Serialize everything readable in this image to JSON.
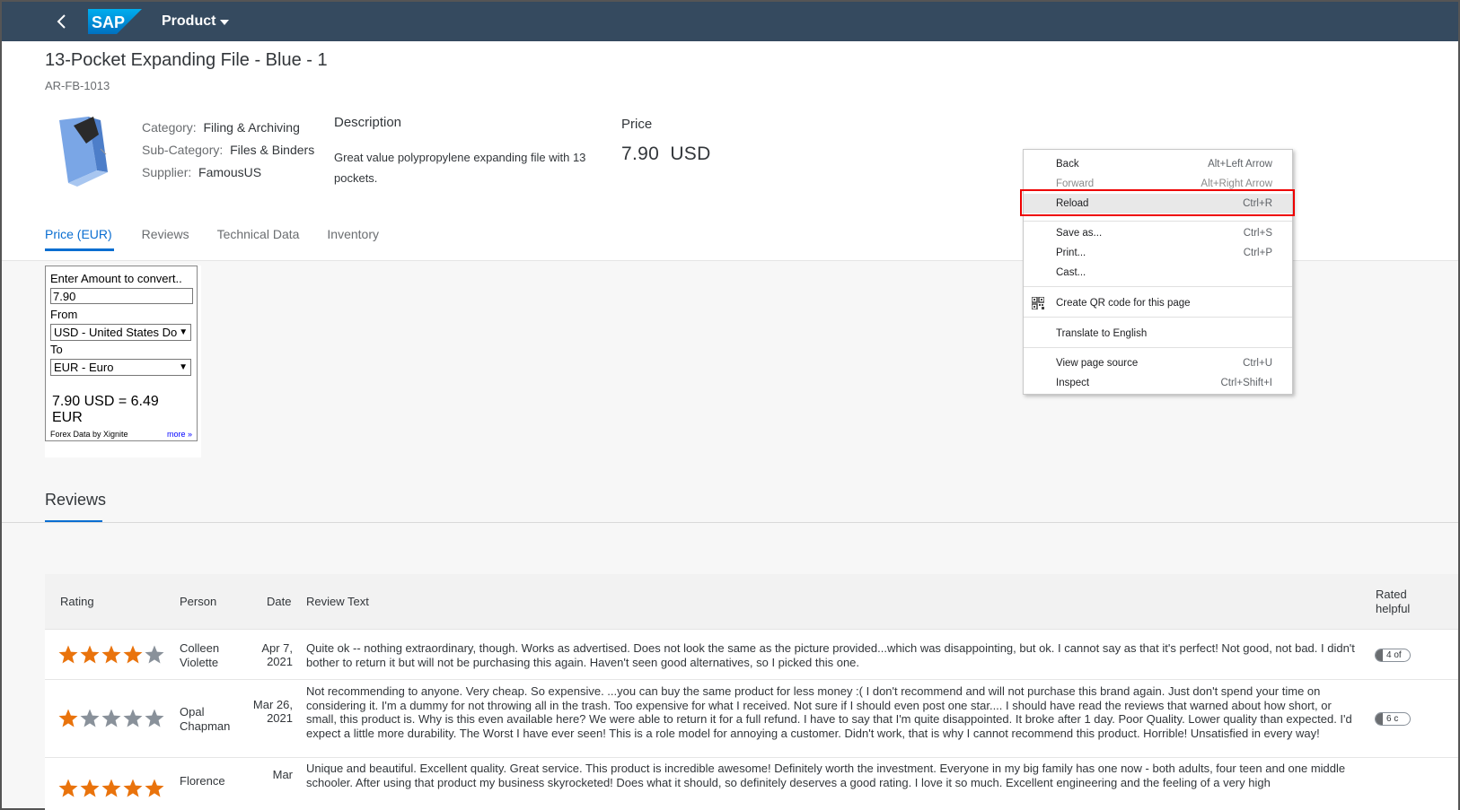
{
  "shell": {
    "app_title": "Product",
    "logo_text": "SAP"
  },
  "product": {
    "title": "13-Pocket Expanding File - Blue - 1",
    "id": "AR-FB-1013",
    "category_label": "Category:",
    "category": "Filing & Archiving",
    "subcategory_label": "Sub-Category:",
    "subcategory": "Files & Binders",
    "supplier_label": "Supplier:",
    "supplier": "FamousUS",
    "description_heading": "Description",
    "description": "Great value polypropylene expanding file with 13 pockets.",
    "price_heading": "Price",
    "price": "7.90  USD"
  },
  "tabs": [
    "Price (EUR)",
    "Reviews",
    "Technical Data",
    "Inventory"
  ],
  "converter": {
    "amount_label": "Enter Amount to convert..",
    "amount_value": "7.90",
    "from_label": "From",
    "from_value": "USD - United States Do",
    "to_label": "To",
    "to_value": "EUR - Euro",
    "result": "7.90 USD = 6.49 EUR",
    "footer": "Forex Data by Xignite",
    "more_link": "more »"
  },
  "reviews": {
    "heading": "Reviews",
    "columns": {
      "rating": "Rating",
      "person": "Person",
      "date": "Date",
      "text": "Review Text",
      "helpful": "Rated helpful"
    },
    "rows": [
      {
        "rating": 4,
        "person": "Colleen Violette",
        "date": "Apr 7, 2021",
        "text": "Quite ok -- nothing extraordinary, though. Works as advertised. Does not look the same as the picture provided...which was disappointing, but ok. I cannot say as that it's perfect! Not good, not bad. I didn't bother to return it but will not be purchasing this again. Haven't seen good alternatives, so I picked this one.",
        "helpful": "4 of"
      },
      {
        "rating": 1,
        "person": "Opal Chapman",
        "date": "Mar 26, 2021",
        "text": "Not recommending to anyone. Very cheap. So expensive. ...you can buy the same product for less money :( I don't recommend and will not purchase this brand again. Just don't spend your time on considering it. I'm a dummy for not throwing all in the trash. Too expensive for what I received. Not sure if I should even post one star.... I should have read the reviews that warned about how short, or small, this product is. Why is this even available here? We were able to return it for a full refund. I have to say that I'm quite disappointed. It broke after 1 day. Poor Quality. Lower quality than expected. I'd expect a little more durability. The Worst I have ever seen! This is a role model for annoying a customer. Didn't work, that is why I cannot recommend this product. Horrible! Unsatisfied in every way!",
        "helpful": "6 c"
      },
      {
        "rating": 5,
        "person": "Florence",
        "date": "Mar",
        "text": "Unique and beautiful. Excellent quality. Great service. This product is incredible awesome! Definitely worth the investment. Everyone in my big family has one now - both adults, four teen and one middle schooler. After using that product my business skyrocketed! Does what it should, so definitely deserves a good rating. I love it so much. Excellent engineering and the feeling of a very high",
        "helpful": ""
      }
    ]
  },
  "context_menu": {
    "items": [
      {
        "label": "Back",
        "shortcut": "Alt+Left Arrow"
      },
      {
        "label": "Forward",
        "shortcut": "Alt+Right Arrow"
      },
      {
        "label": "Reload",
        "shortcut": "Ctrl+R"
      },
      {
        "label": "Save as...",
        "shortcut": "Ctrl+S"
      },
      {
        "label": "Print...",
        "shortcut": "Ctrl+P"
      },
      {
        "label": "Cast...",
        "shortcut": ""
      },
      {
        "label": "Create QR code for this page",
        "shortcut": ""
      },
      {
        "label": "Translate to English",
        "shortcut": ""
      },
      {
        "label": "View page source",
        "shortcut": "Ctrl+U"
      },
      {
        "label": "Inspect",
        "shortcut": "Ctrl+Shift+I"
      }
    ]
  },
  "colors": {
    "shell": "#354a5f",
    "accent": "#0a6ed1",
    "star": "#e9730c",
    "star_empty": "#89919a",
    "highlight_box": "#ee0000"
  }
}
